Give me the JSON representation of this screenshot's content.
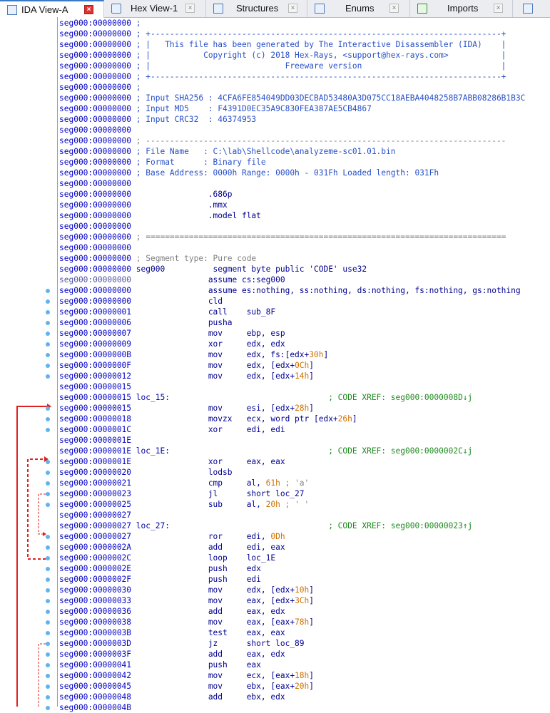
{
  "tabs": [
    {
      "label": "IDA View-A",
      "icon": "ida-view-icon",
      "active": true
    },
    {
      "label": "Hex View-1",
      "icon": "hex-view-icon",
      "active": false
    },
    {
      "label": "Structures",
      "icon": "structures-icon",
      "active": false
    },
    {
      "label": "Enums",
      "icon": "enums-icon",
      "active": false
    },
    {
      "label": "Imports",
      "icon": "imports-icon",
      "active": false
    },
    {
      "label": "",
      "icon": "exports-icon",
      "active": false
    }
  ],
  "close_glyph": "×",
  "colors": {
    "address": "#0000c8",
    "comment": "#2850c8",
    "xref": "#1f8a1f",
    "immediate": "#d07000",
    "jump_arrow_solid": "#e02020",
    "breakpoint_dot": "#5fb4ec"
  },
  "lines": [
    {
      "addr": "seg000:00000000",
      "dot": false,
      "parts": [
        {
          "t": " ;",
          "c": "cmt"
        }
      ]
    },
    {
      "addr": "seg000:00000000",
      "dot": false,
      "parts": [
        {
          "t": " ; +-------------------------------------------------------------------------+",
          "c": "cmt"
        }
      ]
    },
    {
      "addr": "seg000:00000000",
      "dot": false,
      "parts": [
        {
          "t": " ; |   This file has been generated by The Interactive Disassembler (IDA)    |",
          "c": "cmt"
        }
      ]
    },
    {
      "addr": "seg000:00000000",
      "dot": false,
      "parts": [
        {
          "t": " ; |           Copyright (c) 2018 Hex-Rays, <support@hex-rays.com>           |",
          "c": "cmt"
        }
      ]
    },
    {
      "addr": "seg000:00000000",
      "dot": false,
      "parts": [
        {
          "t": " ; |                            Freeware version                             |",
          "c": "cmt"
        }
      ]
    },
    {
      "addr": "seg000:00000000",
      "dot": false,
      "parts": [
        {
          "t": " ; +-------------------------------------------------------------------------+",
          "c": "cmt"
        }
      ]
    },
    {
      "addr": "seg000:00000000",
      "dot": false,
      "parts": [
        {
          "t": " ;",
          "c": "cmt"
        }
      ]
    },
    {
      "addr": "seg000:00000000",
      "dot": false,
      "parts": [
        {
          "t": " ; Input SHA256 : 4CFA6FE854049DD03DECBAD53480A3D075CC18AEBA4048258B7ABB08286B1B3C",
          "c": "cmt"
        }
      ]
    },
    {
      "addr": "seg000:00000000",
      "dot": false,
      "parts": [
        {
          "t": " ; Input MD5    : F4391D0EC35A9C830FEA387AE5CB4867",
          "c": "cmt"
        }
      ]
    },
    {
      "addr": "seg000:00000000",
      "dot": false,
      "parts": [
        {
          "t": " ; Input CRC32  : 46374953",
          "c": "cmt"
        }
      ]
    },
    {
      "addr": "seg000:00000000",
      "dot": false,
      "parts": []
    },
    {
      "addr": "seg000:00000000",
      "dot": false,
      "parts": [
        {
          "t": " ; ---------------------------------------------------------------------------",
          "c": "cmtg"
        }
      ]
    },
    {
      "addr": "seg000:00000000",
      "dot": false,
      "parts": [
        {
          "t": " ; File Name   : C:\\lab\\Shellcode\\analyzeme-sc01.01.bin",
          "c": "cmt"
        }
      ]
    },
    {
      "addr": "seg000:00000000",
      "dot": false,
      "parts": [
        {
          "t": " ; Format      : Binary file",
          "c": "cmt"
        }
      ]
    },
    {
      "addr": "seg000:00000000",
      "dot": false,
      "parts": [
        {
          "t": " ; Base Address: 0000h Range: 0000h - 031Fh Loaded length: 031Fh",
          "c": "cmt"
        }
      ]
    },
    {
      "addr": "seg000:00000000",
      "dot": false,
      "parts": []
    },
    {
      "addr": "seg000:00000000",
      "dot": false,
      "parts": [
        {
          "t": "                .686p",
          "c": "mn"
        }
      ]
    },
    {
      "addr": "seg000:00000000",
      "dot": false,
      "parts": [
        {
          "t": "                .mmx",
          "c": "mn"
        }
      ]
    },
    {
      "addr": "seg000:00000000",
      "dot": false,
      "parts": [
        {
          "t": "                .model flat",
          "c": "mn"
        }
      ]
    },
    {
      "addr": "seg000:00000000",
      "dot": false,
      "parts": []
    },
    {
      "addr": "seg000:00000000",
      "dot": false,
      "parts": [
        {
          "t": " ; ===========================================================================",
          "c": "cmtg"
        }
      ]
    },
    {
      "addr": "seg000:00000000",
      "dot": false,
      "parts": []
    },
    {
      "addr": "seg000:00000000",
      "dot": false,
      "parts": [
        {
          "t": " ; Segment type: Pure code",
          "c": "cmtg"
        }
      ]
    },
    {
      "addr": "seg000:00000000",
      "dot": false,
      "parts": [
        {
          "t": " seg000          segment byte public 'CODE' use32",
          "c": "mn"
        }
      ]
    },
    {
      "addr": "seg000:00000000",
      "seg": true,
      "dot": false,
      "parts": [
        {
          "t": "                assume cs:seg000",
          "c": "mn"
        }
      ]
    },
    {
      "addr": "seg000:00000000",
      "dot": true,
      "parts": [
        {
          "t": "                assume es:nothing, ss:nothing, ds:nothing, fs:nothing, gs:nothing",
          "c": "mn"
        }
      ]
    },
    {
      "addr": "seg000:00000000",
      "dot": true,
      "parts": [
        {
          "t": "                cld",
          "c": "mn"
        }
      ]
    },
    {
      "addr": "seg000:00000001",
      "dot": true,
      "parts": [
        {
          "t": "                call    sub_8F",
          "c": "mn"
        }
      ]
    },
    {
      "addr": "seg000:00000006",
      "dot": true,
      "parts": [
        {
          "t": "                pusha",
          "c": "mn"
        }
      ]
    },
    {
      "addr": "seg000:00000007",
      "dot": true,
      "parts": [
        {
          "t": "                mov     ebp, esp",
          "c": "mn"
        }
      ]
    },
    {
      "addr": "seg000:00000009",
      "dot": true,
      "parts": [
        {
          "t": "                xor     edx, edx",
          "c": "mn"
        }
      ]
    },
    {
      "addr": "seg000:0000000B",
      "dot": true,
      "parts": [
        {
          "t": "                mov     edx, fs:[edx+",
          "c": "mn"
        },
        {
          "t": "30h",
          "c": "num"
        },
        {
          "t": "]",
          "c": "mn"
        }
      ]
    },
    {
      "addr": "seg000:0000000F",
      "dot": true,
      "parts": [
        {
          "t": "                mov     edx, [edx+",
          "c": "mn"
        },
        {
          "t": "0Ch",
          "c": "num"
        },
        {
          "t": "]",
          "c": "mn"
        }
      ]
    },
    {
      "addr": "seg000:00000012",
      "dot": true,
      "parts": [
        {
          "t": "                mov     edx, [edx+",
          "c": "mn"
        },
        {
          "t": "14h",
          "c": "num"
        },
        {
          "t": "]",
          "c": "mn"
        }
      ]
    },
    {
      "addr": "seg000:00000015",
      "dot": false,
      "parts": []
    },
    {
      "addr": "seg000:00000015",
      "dot": false,
      "parts": [
        {
          "t": " loc_15:",
          "c": "lbl"
        },
        {
          "t": "                                 ; CODE XREF: seg000:0000008D↓j",
          "c": "xref"
        }
      ]
    },
    {
      "addr": "seg000:00000015",
      "dot": true,
      "parts": [
        {
          "t": "                mov     esi, [edx+",
          "c": "mn"
        },
        {
          "t": "28h",
          "c": "num"
        },
        {
          "t": "]",
          "c": "mn"
        }
      ]
    },
    {
      "addr": "seg000:00000018",
      "dot": true,
      "parts": [
        {
          "t": "                movzx   ecx, word ptr [edx+",
          "c": "mn"
        },
        {
          "t": "26h",
          "c": "num"
        },
        {
          "t": "]",
          "c": "mn"
        }
      ]
    },
    {
      "addr": "seg000:0000001C",
      "dot": true,
      "parts": [
        {
          "t": "                xor     edi, edi",
          "c": "mn"
        }
      ]
    },
    {
      "addr": "seg000:0000001E",
      "dot": false,
      "parts": []
    },
    {
      "addr": "seg000:0000001E",
      "dot": false,
      "parts": [
        {
          "t": " loc_1E:",
          "c": "lbl"
        },
        {
          "t": "                                 ; CODE XREF: seg000:0000002C↓j",
          "c": "xref"
        }
      ]
    },
    {
      "addr": "seg000:0000001E",
      "dot": true,
      "parts": [
        {
          "t": "                xor     eax, eax",
          "c": "mn"
        }
      ]
    },
    {
      "addr": "seg000:00000020",
      "dot": true,
      "parts": [
        {
          "t": "                lodsb",
          "c": "mn"
        }
      ]
    },
    {
      "addr": "seg000:00000021",
      "dot": true,
      "parts": [
        {
          "t": "                cmp     al, ",
          "c": "mn"
        },
        {
          "t": "61h",
          "c": "num"
        },
        {
          "t": " ; 'a'",
          "c": "cmtg"
        }
      ]
    },
    {
      "addr": "seg000:00000023",
      "dot": true,
      "parts": [
        {
          "t": "                jl      short loc_27",
          "c": "mn"
        }
      ]
    },
    {
      "addr": "seg000:00000025",
      "dot": true,
      "parts": [
        {
          "t": "                sub     al, ",
          "c": "mn"
        },
        {
          "t": "20h",
          "c": "num"
        },
        {
          "t": " ; ' '",
          "c": "cmtg"
        }
      ]
    },
    {
      "addr": "seg000:00000027",
      "dot": false,
      "parts": []
    },
    {
      "addr": "seg000:00000027",
      "dot": false,
      "parts": [
        {
          "t": " loc_27:",
          "c": "lbl"
        },
        {
          "t": "                                 ; CODE XREF: seg000:00000023↑j",
          "c": "xref"
        }
      ]
    },
    {
      "addr": "seg000:00000027",
      "dot": true,
      "parts": [
        {
          "t": "                ror     edi, ",
          "c": "mn"
        },
        {
          "t": "0Dh",
          "c": "num"
        }
      ]
    },
    {
      "addr": "seg000:0000002A",
      "dot": true,
      "parts": [
        {
          "t": "                add     edi, eax",
          "c": "mn"
        }
      ]
    },
    {
      "addr": "seg000:0000002C",
      "dot": true,
      "parts": [
        {
          "t": "                loop    loc_1E",
          "c": "mn"
        }
      ]
    },
    {
      "addr": "seg000:0000002E",
      "dot": true,
      "parts": [
        {
          "t": "                push    edx",
          "c": "mn"
        }
      ]
    },
    {
      "addr": "seg000:0000002F",
      "dot": true,
      "parts": [
        {
          "t": "                push    edi",
          "c": "mn"
        }
      ]
    },
    {
      "addr": "seg000:00000030",
      "dot": true,
      "parts": [
        {
          "t": "                mov     edx, [edx+",
          "c": "mn"
        },
        {
          "t": "10h",
          "c": "num"
        },
        {
          "t": "]",
          "c": "mn"
        }
      ]
    },
    {
      "addr": "seg000:00000033",
      "dot": true,
      "parts": [
        {
          "t": "                mov     eax, [edx+",
          "c": "mn"
        },
        {
          "t": "3Ch",
          "c": "num"
        },
        {
          "t": "]",
          "c": "mn"
        }
      ]
    },
    {
      "addr": "seg000:00000036",
      "dot": true,
      "parts": [
        {
          "t": "                add     eax, edx",
          "c": "mn"
        }
      ]
    },
    {
      "addr": "seg000:00000038",
      "dot": true,
      "parts": [
        {
          "t": "                mov     eax, [eax+",
          "c": "mn"
        },
        {
          "t": "78h",
          "c": "num"
        },
        {
          "t": "]",
          "c": "mn"
        }
      ]
    },
    {
      "addr": "seg000:0000003B",
      "dot": true,
      "parts": [
        {
          "t": "                test    eax, eax",
          "c": "mn"
        }
      ]
    },
    {
      "addr": "seg000:0000003D",
      "dot": true,
      "parts": [
        {
          "t": "                jz      short loc_89",
          "c": "mn"
        }
      ]
    },
    {
      "addr": "seg000:0000003F",
      "dot": true,
      "parts": [
        {
          "t": "                add     eax, edx",
          "c": "mn"
        }
      ]
    },
    {
      "addr": "seg000:00000041",
      "dot": true,
      "parts": [
        {
          "t": "                push    eax",
          "c": "mn"
        }
      ]
    },
    {
      "addr": "seg000:00000042",
      "dot": true,
      "parts": [
        {
          "t": "                mov     ecx, [eax+",
          "c": "mn"
        },
        {
          "t": "18h",
          "c": "num"
        },
        {
          "t": "]",
          "c": "mn"
        }
      ]
    },
    {
      "addr": "seg000:00000045",
      "dot": true,
      "parts": [
        {
          "t": "                mov     ebx, [eax+",
          "c": "mn"
        },
        {
          "t": "20h",
          "c": "num"
        },
        {
          "t": "]",
          "c": "mn"
        }
      ]
    },
    {
      "addr": "seg000:00000048",
      "dot": true,
      "parts": [
        {
          "t": "                add     ebx, edx",
          "c": "mn"
        }
      ]
    },
    {
      "addr": "seg000:0000004B",
      "dot": true,
      "parts": []
    }
  ]
}
